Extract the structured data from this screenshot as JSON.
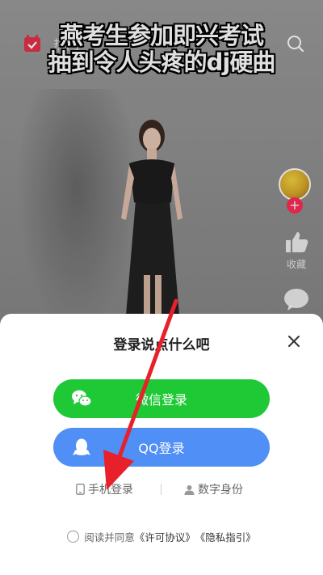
{
  "headline": {
    "line1": "燕考生参加即兴考试",
    "line2": "抽到令人头疼的dj硬曲"
  },
  "top_bar": {
    "tab_label": "热门"
  },
  "rail": {
    "like_label": "收藏",
    "follow_symbol": "+"
  },
  "login_sheet": {
    "title": "登录说点什么吧",
    "wechat_label": "微信登录",
    "qq_label": "QQ登录",
    "phone_label": "手机登录",
    "id_label": "数字身份",
    "agree_prefix": "阅读并同意",
    "license_link": "《许可协议》",
    "privacy_link": "《隐私指引》"
  },
  "colors": {
    "wechat": "#1fc936",
    "qq": "#4f8ff6",
    "annotation": "#e8202a"
  },
  "icons": [
    "calendar-icon",
    "search-icon",
    "like-icon",
    "comment-icon",
    "close-icon",
    "wechat-icon",
    "qq-icon",
    "phone-icon",
    "person-icon"
  ]
}
